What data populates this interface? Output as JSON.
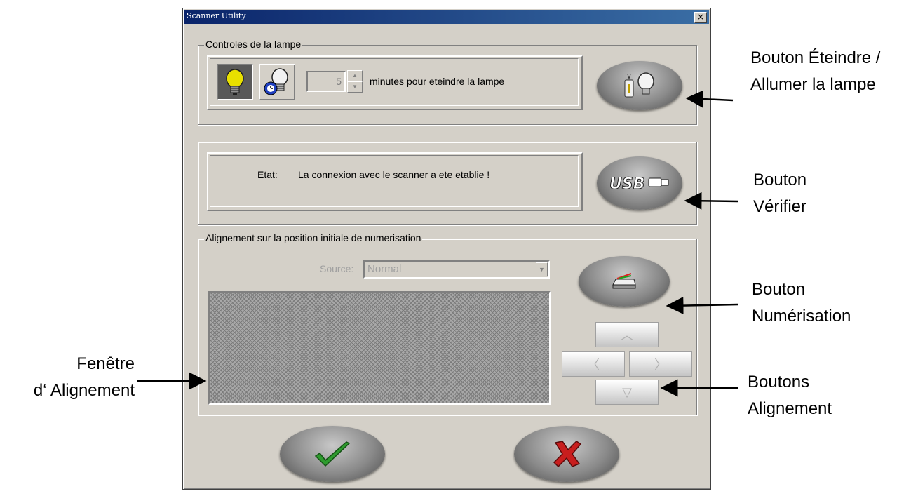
{
  "window": {
    "title": "Scanner Utility",
    "close_glyph": "×"
  },
  "lamp": {
    "group_label": "Controles de la lampe",
    "lamp_on_icon": "light-bulb-on-icon",
    "timer_icon": "timer-bulb-icon",
    "minutes_value": "5",
    "minutes_label": "minutes pour eteindre la lampe",
    "toggle_button_icon": "lamp-switch-icon"
  },
  "status": {
    "label": "Etat:",
    "message": "La connexion avec le scanner a ete etablie !",
    "verify_button_icon": "usb-icon"
  },
  "alignment": {
    "group_label": "Alignement sur la position initiale de numerisation",
    "source_label": "Source:",
    "source_value": "Normal",
    "scan_button_icon": "scanner-icon",
    "nudge_up": "︿",
    "nudge_left": "〈",
    "nudge_right": "〉",
    "nudge_down": "▽"
  },
  "footer": {
    "ok_icon": "checkmark-icon",
    "cancel_icon": "red-x-icon"
  },
  "annotations": {
    "lamp_button": [
      "Bouton Éteindre /",
      "Allumer la lampe"
    ],
    "verify_button": [
      "Bouton",
      "Vérifier"
    ],
    "scan_button": [
      "Bouton",
      "Numérisation"
    ],
    "align_buttons": [
      "Boutons",
      "Alignement"
    ],
    "align_window": [
      "Fenêtre",
      "d‘ Alignement"
    ]
  },
  "colors": {
    "dialog_bg": "#d4d0c8",
    "titlebar": "#0a246a",
    "ok_green": "#2e9b2e",
    "cancel_red": "#c81e1e"
  }
}
